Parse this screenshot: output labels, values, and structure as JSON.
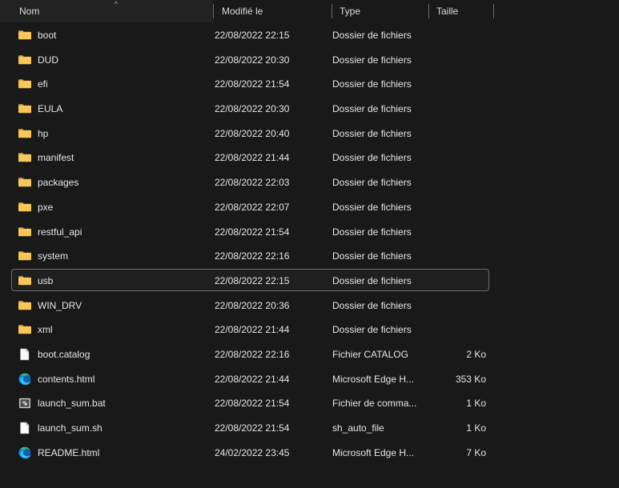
{
  "window": {
    "accent_folder_color": "#F7C657",
    "background": "#191919",
    "selection_border": "#6b6b6b"
  },
  "columns": {
    "name": "Nom",
    "date_modified": "Modifié le",
    "type": "Type",
    "size": "Taille",
    "sort_indicator": "ascending",
    "sort_column": "Nom"
  },
  "rows": [
    {
      "icon": "folder-icon",
      "name": "boot",
      "date": "22/08/2022 22:15",
      "type": "Dossier de fichiers",
      "size": "",
      "selected": false
    },
    {
      "icon": "folder-icon",
      "name": "DUD",
      "date": "22/08/2022 20:30",
      "type": "Dossier de fichiers",
      "size": "",
      "selected": false
    },
    {
      "icon": "folder-icon",
      "name": "efi",
      "date": "22/08/2022 21:54",
      "type": "Dossier de fichiers",
      "size": "",
      "selected": false
    },
    {
      "icon": "folder-icon",
      "name": "EULA",
      "date": "22/08/2022 20:30",
      "type": "Dossier de fichiers",
      "size": "",
      "selected": false
    },
    {
      "icon": "folder-icon",
      "name": "hp",
      "date": "22/08/2022 20:40",
      "type": "Dossier de fichiers",
      "size": "",
      "selected": false
    },
    {
      "icon": "folder-icon",
      "name": "manifest",
      "date": "22/08/2022 21:44",
      "type": "Dossier de fichiers",
      "size": "",
      "selected": false
    },
    {
      "icon": "folder-icon",
      "name": "packages",
      "date": "22/08/2022 22:03",
      "type": "Dossier de fichiers",
      "size": "",
      "selected": false
    },
    {
      "icon": "folder-icon",
      "name": "pxe",
      "date": "22/08/2022 22:07",
      "type": "Dossier de fichiers",
      "size": "",
      "selected": false
    },
    {
      "icon": "folder-icon",
      "name": "restful_api",
      "date": "22/08/2022 21:54",
      "type": "Dossier de fichiers",
      "size": "",
      "selected": false
    },
    {
      "icon": "folder-icon",
      "name": "system",
      "date": "22/08/2022 22:16",
      "type": "Dossier de fichiers",
      "size": "",
      "selected": false
    },
    {
      "icon": "folder-icon",
      "name": "usb",
      "date": "22/08/2022 22:15",
      "type": "Dossier de fichiers",
      "size": "",
      "selected": true
    },
    {
      "icon": "folder-icon",
      "name": "WIN_DRV",
      "date": "22/08/2022 20:36",
      "type": "Dossier de fichiers",
      "size": "",
      "selected": false
    },
    {
      "icon": "folder-icon",
      "name": "xml",
      "date": "22/08/2022 21:44",
      "type": "Dossier de fichiers",
      "size": "",
      "selected": false
    },
    {
      "icon": "generic-file-icon",
      "name": "boot.catalog",
      "date": "22/08/2022 22:16",
      "type": "Fichier CATALOG",
      "size": "2 Ko",
      "selected": false
    },
    {
      "icon": "edge-html-icon",
      "name": "contents.html",
      "date": "22/08/2022 21:44",
      "type": "Microsoft Edge H...",
      "size": "353 Ko",
      "selected": false
    },
    {
      "icon": "batch-file-icon",
      "name": "launch_sum.bat",
      "date": "22/08/2022 21:54",
      "type": "Fichier de comma...",
      "size": "1 Ko",
      "selected": false
    },
    {
      "icon": "generic-file-icon",
      "name": "launch_sum.sh",
      "date": "22/08/2022 21:54",
      "type": "sh_auto_file",
      "size": "1 Ko",
      "selected": false
    },
    {
      "icon": "edge-html-icon",
      "name": "README.html",
      "date": "24/02/2022 23:45",
      "type": "Microsoft Edge H...",
      "size": "7 Ko",
      "selected": false
    }
  ]
}
